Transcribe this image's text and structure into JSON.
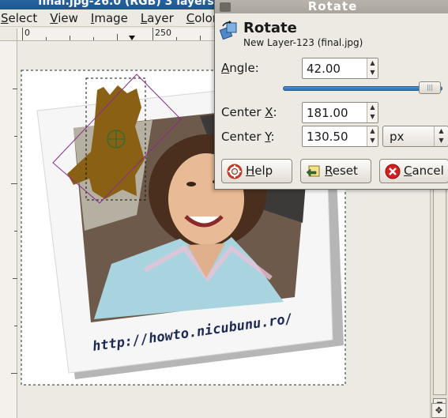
{
  "window": {
    "title": "final.jpg-26.0 (RGB) 3 layers",
    "menu": [
      "Select",
      "View",
      "Image",
      "Layer",
      "Colors"
    ]
  },
  "ruler": {
    "h_labels": [
      "0",
      "250"
    ]
  },
  "canvas": {
    "photo_caption": "http://howto.nicubunu.ro/"
  },
  "dialog": {
    "title": "Rotate",
    "heading": "Rotate",
    "subtitle": "New Layer-123 (final.jpg)",
    "angle": {
      "label": "Angle:",
      "value": "42.00"
    },
    "center_x": {
      "label": "Center X:",
      "value": "181.00"
    },
    "center_y": {
      "label": "Center Y:",
      "value": "130.50"
    },
    "unit": "px",
    "buttons": {
      "help": "Help",
      "reset": "Reset",
      "cancel": "Cancel"
    },
    "icons": {
      "header": "rotate-icon",
      "help": "help-lifebuoy-icon",
      "reset": "reset-icon",
      "cancel": "cancel-icon"
    },
    "colors": {
      "slider": "#3a7fc2",
      "cancel_icon": "#d21f1f"
    }
  }
}
